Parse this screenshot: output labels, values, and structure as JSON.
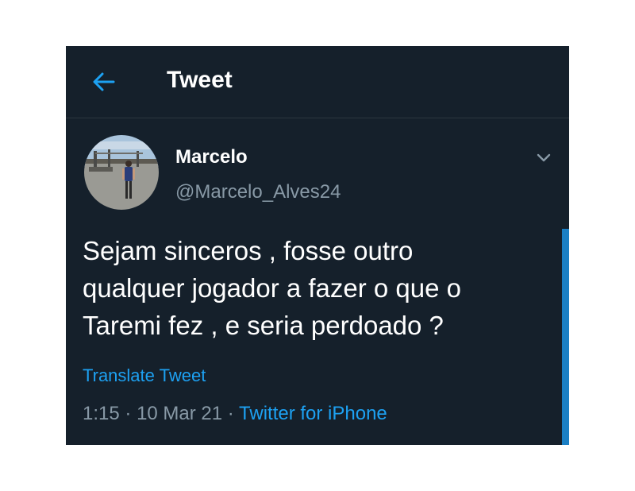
{
  "header": {
    "title": "Tweet",
    "back_icon": "arrow-left-icon",
    "accent_color": "#1da1f2"
  },
  "tweet": {
    "author": {
      "name": "Marcelo",
      "handle": "@Marcelo_Alves24",
      "avatar_icon": "profile-photo"
    },
    "menu_icon": "chevron-down-icon",
    "text_lines": [
      "Sejam sinceros , fosse outro",
      "qualquer jogador a fazer o que o",
      "Taremi fez , e seria perdoado ?"
    ],
    "translate_label": "Translate Tweet",
    "time": "1:15",
    "separator": "·",
    "date": "10 Mar 21",
    "source": "Twitter for iPhone"
  },
  "colors": {
    "background": "#15202b",
    "secondary_text": "#8899a6",
    "primary_text": "#ffffff"
  }
}
